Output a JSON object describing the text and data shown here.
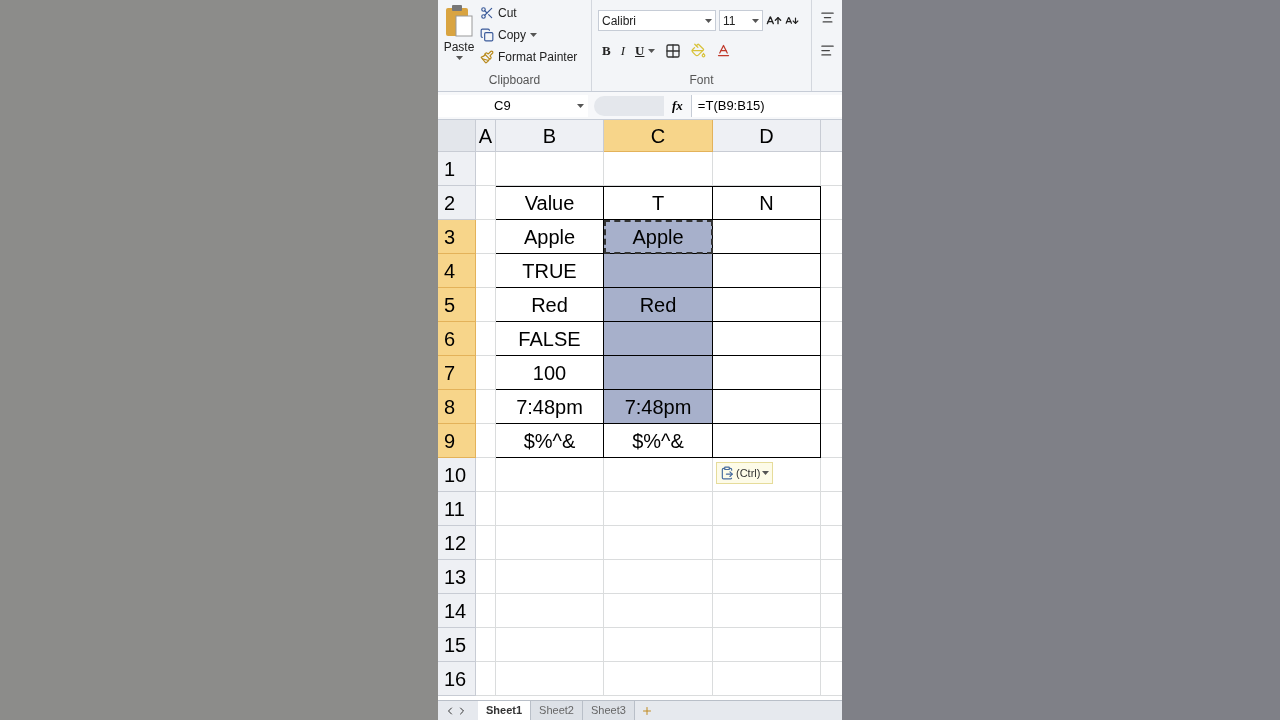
{
  "ribbon": {
    "clipboard": {
      "paste": "Paste",
      "cut": "Cut",
      "copy": "Copy",
      "format_painter": "Format Painter",
      "group_label": "Clipboard"
    },
    "font": {
      "font_name": "Calibri",
      "font_size": "11",
      "bold": "B",
      "italic": "I",
      "underline": "U",
      "group_label": "Font"
    }
  },
  "formula_bar": {
    "name_box": "C9",
    "fx_label": "fx",
    "formula": "=T(B9:B15)"
  },
  "columns": [
    {
      "label": "A",
      "selected": false
    },
    {
      "label": "B",
      "selected": false
    },
    {
      "label": "C",
      "selected": true
    },
    {
      "label": "D",
      "selected": false
    }
  ],
  "rows": [
    {
      "label": "1",
      "selected": false,
      "in_table": false
    },
    {
      "label": "2",
      "selected": false,
      "in_table": true,
      "B": "Value",
      "C": "T",
      "D": "N"
    },
    {
      "label": "3",
      "selected": true,
      "in_table": true,
      "B": "Apple",
      "C": "Apple",
      "c_selected": true,
      "c_copied": true
    },
    {
      "label": "4",
      "selected": true,
      "in_table": true,
      "B": "TRUE",
      "c_selected": true
    },
    {
      "label": "5",
      "selected": true,
      "in_table": true,
      "B": "Red",
      "C": "Red",
      "c_selected": true
    },
    {
      "label": "6",
      "selected": true,
      "in_table": true,
      "B": "FALSE",
      "c_selected": true
    },
    {
      "label": "7",
      "selected": true,
      "in_table": true,
      "B": "100",
      "c_selected": true
    },
    {
      "label": "8",
      "selected": true,
      "in_table": true,
      "B": "7:48pm",
      "C": "7:48pm",
      "c_selected": true
    },
    {
      "label": "9",
      "selected": true,
      "in_table": true,
      "B": "$%^&",
      "C": "$%^&",
      "c_selected": false
    },
    {
      "label": "10",
      "selected": false,
      "in_table": false,
      "paste_options": "(Ctrl)"
    },
    {
      "label": "11",
      "selected": false,
      "in_table": false
    },
    {
      "label": "12",
      "selected": false,
      "in_table": false
    },
    {
      "label": "13",
      "selected": false,
      "in_table": false
    },
    {
      "label": "14",
      "selected": false,
      "in_table": false
    },
    {
      "label": "15",
      "selected": false,
      "in_table": false
    },
    {
      "label": "16",
      "selected": false,
      "in_table": false
    }
  ],
  "sheet_tabs": [
    {
      "label": "Sheet1",
      "selected": true
    },
    {
      "label": "Sheet2",
      "selected": false
    },
    {
      "label": "Sheet3",
      "selected": false
    }
  ]
}
